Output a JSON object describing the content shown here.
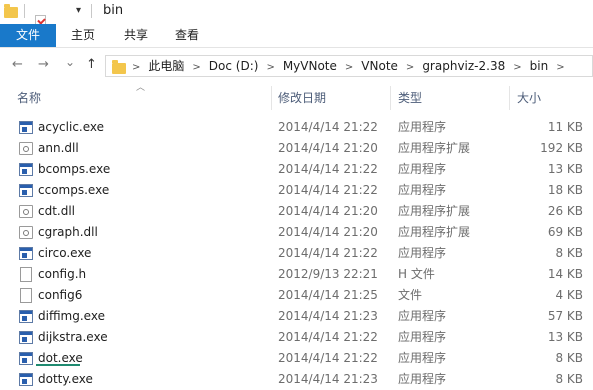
{
  "titlebar": {
    "title": "bin"
  },
  "ribbon": {
    "tabs": [
      "文件",
      "主页",
      "共享",
      "查看"
    ]
  },
  "nav": {
    "back": "←",
    "forward": "→",
    "dropdown": "⌄",
    "up": "↑"
  },
  "address": {
    "crumbs": [
      "此电脑",
      "Doc (D:)",
      "MyVNote",
      "VNote",
      "graphviz-2.38",
      "bin"
    ]
  },
  "columns": {
    "name": "名称",
    "date": "修改日期",
    "type": "类型",
    "size": "大小"
  },
  "files": [
    {
      "icon": "exe-icon",
      "name": "acyclic.exe",
      "date": "2014/4/14 21:22",
      "type": "应用程序",
      "size": "11 KB"
    },
    {
      "icon": "dll-icon",
      "name": "ann.dll",
      "date": "2014/4/14 21:20",
      "type": "应用程序扩展",
      "size": "192 KB"
    },
    {
      "icon": "exe-icon",
      "name": "bcomps.exe",
      "date": "2014/4/14 21:22",
      "type": "应用程序",
      "size": "13 KB"
    },
    {
      "icon": "exe-icon",
      "name": "ccomps.exe",
      "date": "2014/4/14 21:22",
      "type": "应用程序",
      "size": "18 KB"
    },
    {
      "icon": "dll-icon",
      "name": "cdt.dll",
      "date": "2014/4/14 21:20",
      "type": "应用程序扩展",
      "size": "26 KB"
    },
    {
      "icon": "dll-icon",
      "name": "cgraph.dll",
      "date": "2014/4/14 21:20",
      "type": "应用程序扩展",
      "size": "69 KB"
    },
    {
      "icon": "exe-icon",
      "name": "circo.exe",
      "date": "2014/4/14 21:22",
      "type": "应用程序",
      "size": "8 KB"
    },
    {
      "icon": "file-icon",
      "name": "config.h",
      "date": "2012/9/13 22:21",
      "type": "H 文件",
      "size": "14 KB"
    },
    {
      "icon": "file-icon",
      "name": "config6",
      "date": "2014/4/14 21:25",
      "type": "文件",
      "size": "4 KB"
    },
    {
      "icon": "exe-icon",
      "name": "diffimg.exe",
      "date": "2014/4/14 21:23",
      "type": "应用程序",
      "size": "57 KB"
    },
    {
      "icon": "exe-icon",
      "name": "dijkstra.exe",
      "date": "2014/4/14 21:22",
      "type": "应用程序",
      "size": "13 KB"
    },
    {
      "icon": "exe-icon",
      "name": "dot.exe",
      "date": "2014/4/14 21:22",
      "type": "应用程序",
      "size": "8 KB"
    },
    {
      "icon": "exe-icon",
      "name": "dotty.exe",
      "date": "2014/4/14 21:23",
      "type": "应用程序",
      "size": "8 KB"
    }
  ]
}
